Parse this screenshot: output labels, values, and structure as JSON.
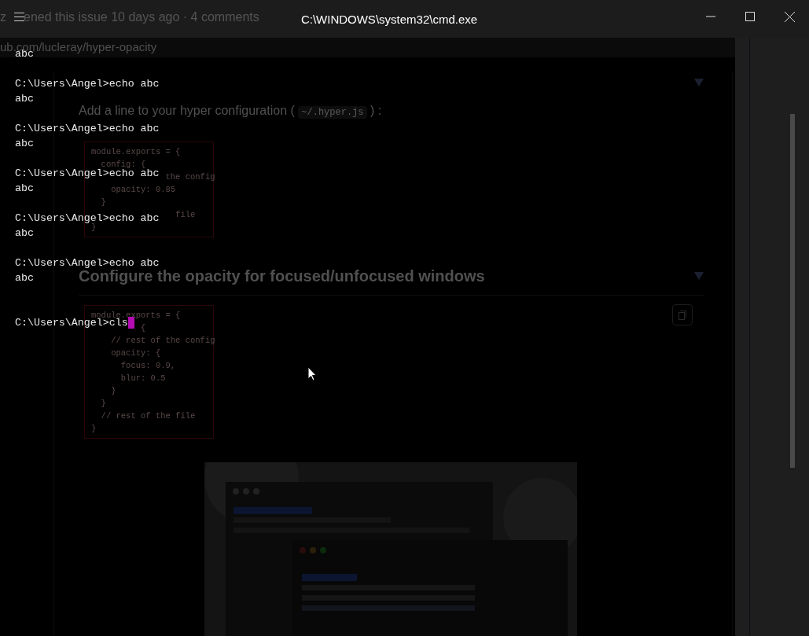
{
  "window": {
    "title": "C:\\WINDOWS\\system32\\cmd.exe"
  },
  "background_page": {
    "issue_meta": [
      "z",
      "ened this issue 10 days ago · 4 comments"
    ],
    "url": "ub.com/lucleray/hyper-opacity",
    "sections": [
      {
        "intro": {
          "before": "Add a line to your hyper configuration (",
          "code": "~/.hyper.js",
          "after": ") :"
        },
        "code": [
          "module.exports = {",
          "  config: {",
          "               the config",
          "    opacity: 0.85",
          "  }",
          "                 file",
          "}"
        ]
      },
      {
        "heading": "Configure the opacity for focused/unfocused windows",
        "copy_button": true,
        "code": [
          "module.exports = {",
          "          {",
          "    // rest of the config",
          "    opacity: {",
          "      focus: 0.9,",
          "      blur: 0.5",
          "    }",
          "  }",
          "  // rest of the file",
          "}"
        ]
      }
    ]
  },
  "terminal": {
    "cursor_visible": true,
    "lines": [
      {
        "kind": "output",
        "text": "abc"
      },
      {
        "kind": "blank"
      },
      {
        "kind": "prompt",
        "text": "C:\\Users\\Angel>echo abc"
      },
      {
        "kind": "output",
        "text": "abc"
      },
      {
        "kind": "blank"
      },
      {
        "kind": "prompt",
        "text": "C:\\Users\\Angel>echo abc"
      },
      {
        "kind": "output",
        "text": "abc"
      },
      {
        "kind": "blank"
      },
      {
        "kind": "prompt",
        "text": "C:\\Users\\Angel>echo abc"
      },
      {
        "kind": "output",
        "text": "abc"
      },
      {
        "kind": "blank"
      },
      {
        "kind": "prompt",
        "text": "C:\\Users\\Angel>echo abc"
      },
      {
        "kind": "output",
        "text": "abc"
      },
      {
        "kind": "blank"
      },
      {
        "kind": "prompt",
        "text": "C:\\Users\\Angel>echo abc"
      },
      {
        "kind": "output",
        "text": "abc"
      },
      {
        "kind": "blank"
      },
      {
        "kind": "blank"
      },
      {
        "kind": "prompt",
        "text": "C:\\Users\\Angel>cls"
      }
    ]
  }
}
